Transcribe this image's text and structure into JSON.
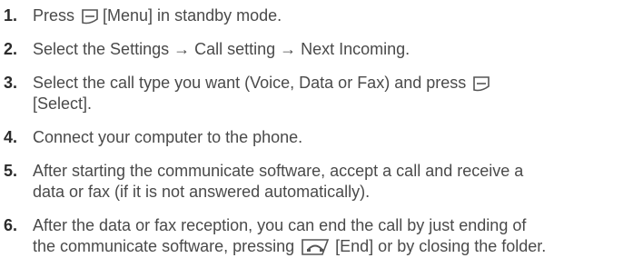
{
  "steps": [
    {
      "number": "1.",
      "before": "Press",
      "icon": "soft-key-icon",
      "after": "[Menu] in standby mode."
    },
    {
      "number": "2.",
      "text": "Select the Settings → Call setting → Next Incoming."
    },
    {
      "number": "3.",
      "line1": "Select the call type you want (Voice, Data or Fax) and press",
      "icon": "soft-key-icon",
      "line2": "[Select]."
    },
    {
      "number": "4.",
      "text": "Connect your computer to the phone."
    },
    {
      "number": "5.",
      "line1": "After starting the communicate software, accept a call and receive a",
      "line2": "data or fax (if it is not answered automatically)."
    },
    {
      "number": "6.",
      "line1": "After the data or fax reception, you can end the call by just ending of",
      "line2_before": "the communicate software, pressing",
      "icon": "end-key-icon",
      "line2_after": "[End] or by closing the folder."
    }
  ],
  "colors": {
    "text": "#4a4a4a",
    "number": "#2b2b2b",
    "icon": "#555555"
  }
}
